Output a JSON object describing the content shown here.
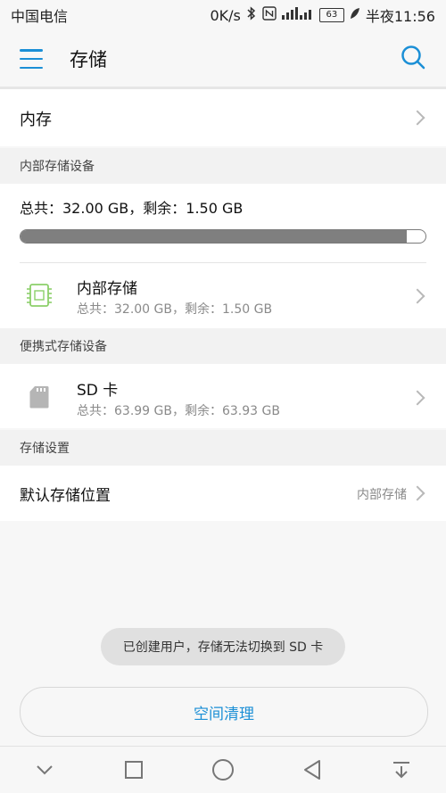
{
  "status": {
    "carrier": "中国电信",
    "speed": "0K/s",
    "battery": "63",
    "time": "半夜11:56"
  },
  "header": {
    "title": "存储"
  },
  "memory_row": {
    "label": "内存"
  },
  "internal_section": {
    "header": "内部存储设备",
    "summary": "总共：32.00 GB，剩余：1.50 GB",
    "used_fraction": 0.953,
    "item": {
      "title": "内部存储",
      "subtitle": "总共：32.00 GB，剩余：1.50 GB"
    }
  },
  "portable_section": {
    "header": "便携式存储设备",
    "item": {
      "title": "SD 卡",
      "subtitle": "总共：63.99 GB，剩余：63.93 GB"
    }
  },
  "settings_section": {
    "header": "存储设置",
    "default_location": {
      "label": "默认存储位置",
      "value": "内部存储"
    }
  },
  "toast": {
    "message": "已创建用户，存储无法切换到 SD 卡"
  },
  "clean_button": {
    "label": "空间清理"
  },
  "colors": {
    "accent": "#1b8fd6",
    "bar_fill": "#7f7f7f",
    "chip_icon": "#8ccf6a"
  }
}
